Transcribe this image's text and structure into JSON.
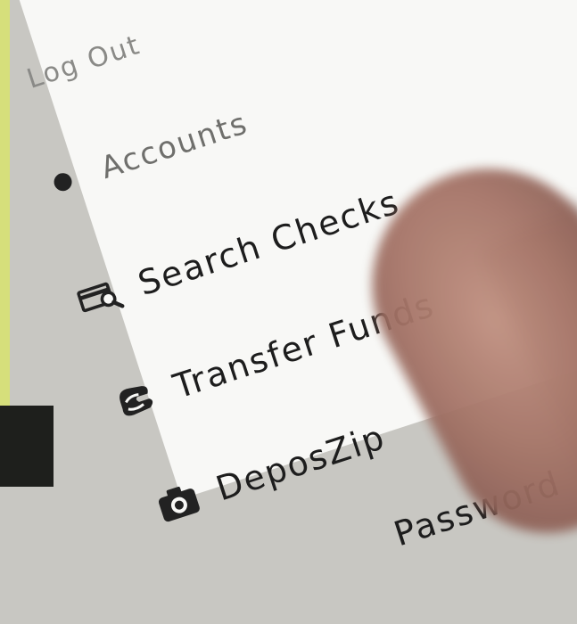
{
  "menu": {
    "items": [
      {
        "label": "Log Out",
        "icon": "none"
      },
      {
        "label": "Accounts",
        "icon": "bullet-icon"
      },
      {
        "label": "Search Checks",
        "icon": "check-search-icon"
      },
      {
        "label": "Transfer Funds",
        "icon": "transfer-hands-icon"
      },
      {
        "label": "DeposZip",
        "icon": "camera-icon"
      },
      {
        "label": "Password",
        "icon": "none"
      }
    ]
  },
  "colors": {
    "screen": "#f8f8f6",
    "text": "#1d1d1d",
    "accent_strip": "#d6df7b"
  }
}
